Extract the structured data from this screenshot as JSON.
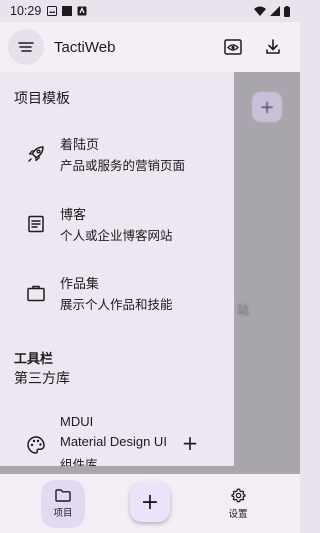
{
  "status_bar": {
    "time": "10:29"
  },
  "app_bar": {
    "title": "TactiWeb"
  },
  "drawer": {
    "templates_title": "项目模板",
    "templates": [
      {
        "icon": "rocket-icon",
        "title": "着陆页",
        "subtitle": "产品或服务的营销页面"
      },
      {
        "icon": "article-icon",
        "title": "博客",
        "subtitle": "个人或企业博客网站"
      },
      {
        "icon": "briefcase-icon",
        "title": "作品集",
        "subtitle": "展示个人作品和技能"
      }
    ],
    "toolbar_title": "工具栏",
    "third_party_title": "第三方库",
    "libraries": [
      {
        "icon": "palette-icon",
        "name": "MDUI",
        "full_name": "Material Design UI",
        "desc": "组件库",
        "add": "+"
      }
    ]
  },
  "bottom_nav": {
    "projects_label": "项目",
    "fab_label": "+",
    "settings_label": "设置"
  },
  "colors": {
    "accent_container": "#e4d9f3",
    "drawer_bg": "#ece7f0",
    "scrim": "#a9a5ad"
  }
}
